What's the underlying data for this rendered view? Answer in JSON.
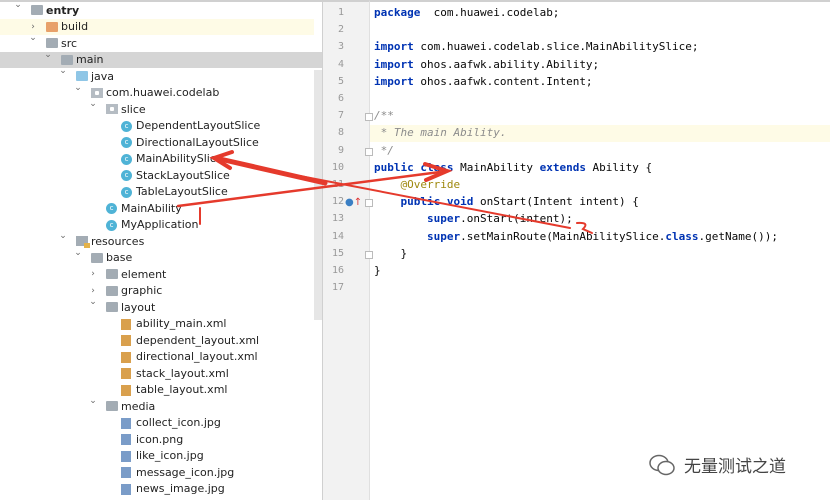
{
  "tree": [
    {
      "label": "entry",
      "level": 0,
      "chev": "down",
      "icon": "module-folder",
      "bold": true
    },
    {
      "label": "build",
      "level": 1,
      "chev": "right",
      "icon": "folder-orange",
      "state": "yellow"
    },
    {
      "label": "src",
      "level": 1,
      "chev": "down",
      "icon": "folder"
    },
    {
      "label": "main",
      "level": 2,
      "chev": "down",
      "icon": "folder",
      "state": "selected"
    },
    {
      "label": "java",
      "level": 3,
      "chev": "down",
      "icon": "folder-blue"
    },
    {
      "label": "com.huawei.codelab",
      "level": 4,
      "chev": "down",
      "icon": "package"
    },
    {
      "label": "slice",
      "level": 5,
      "chev": "down",
      "icon": "package"
    },
    {
      "label": "DependentLayoutSlice",
      "level": 6,
      "icon": "class"
    },
    {
      "label": "DirectionalLayoutSlice",
      "level": 6,
      "icon": "class"
    },
    {
      "label": "MainAbilitySlice",
      "level": 6,
      "icon": "class"
    },
    {
      "label": "StackLayoutSlice",
      "level": 6,
      "icon": "class"
    },
    {
      "label": "TableLayoutSlice",
      "level": 6,
      "icon": "class"
    },
    {
      "label": "MainAbility",
      "level": 5,
      "icon": "class"
    },
    {
      "label": "MyApplication",
      "level": 5,
      "icon": "class"
    },
    {
      "label": "resources",
      "level": 3,
      "chev": "down",
      "icon": "resources"
    },
    {
      "label": "base",
      "level": 4,
      "chev": "down",
      "icon": "folder"
    },
    {
      "label": "element",
      "level": 5,
      "chev": "right",
      "icon": "folder"
    },
    {
      "label": "graphic",
      "level": 5,
      "chev": "right",
      "icon": "folder"
    },
    {
      "label": "layout",
      "level": 5,
      "chev": "down",
      "icon": "folder"
    },
    {
      "label": "ability_main.xml",
      "level": 6,
      "icon": "xml"
    },
    {
      "label": "dependent_layout.xml",
      "level": 6,
      "icon": "xml"
    },
    {
      "label": "directional_layout.xml",
      "level": 6,
      "icon": "xml"
    },
    {
      "label": "stack_layout.xml",
      "level": 6,
      "icon": "xml"
    },
    {
      "label": "table_layout.xml",
      "level": 6,
      "icon": "xml"
    },
    {
      "label": "media",
      "level": 5,
      "chev": "down",
      "icon": "folder"
    },
    {
      "label": "collect_icon.jpg",
      "level": 6,
      "icon": "image"
    },
    {
      "label": "icon.png",
      "level": 6,
      "icon": "image"
    },
    {
      "label": "like_icon.jpg",
      "level": 6,
      "icon": "image"
    },
    {
      "label": "message_icon.jpg",
      "level": 6,
      "icon": "image"
    },
    {
      "label": "news_image.jpg",
      "level": 6,
      "icon": "image"
    }
  ],
  "editor": {
    "highlight_line": 8,
    "lines": [
      [
        [
          "kw",
          "package"
        ],
        [
          "",
          "  com.huawei.codelab;"
        ]
      ],
      [],
      [
        [
          "kw",
          "import"
        ],
        [
          "",
          " com.huawei.codelab.slice.MainAbilitySlice;"
        ]
      ],
      [
        [
          "kw",
          "import"
        ],
        [
          "",
          " ohos.aafwk.ability.Ability;"
        ]
      ],
      [
        [
          "kw",
          "import"
        ],
        [
          "",
          " ohos.aafwk.content.Intent;"
        ]
      ],
      [],
      [
        [
          "cm",
          "/**"
        ]
      ],
      [
        [
          "cm",
          " * The main Ability."
        ]
      ],
      [
        [
          "cm",
          " */"
        ]
      ],
      [
        [
          "kw",
          "public class"
        ],
        [
          "",
          " MainAbility "
        ],
        [
          "kw",
          "extends"
        ],
        [
          "",
          " Ability {"
        ]
      ],
      [
        [
          "an",
          "    @Override"
        ]
      ],
      [
        [
          "",
          "    "
        ],
        [
          "kw",
          "public void"
        ],
        [
          "",
          " onStart(Intent intent) {"
        ]
      ],
      [
        [
          "",
          "        "
        ],
        [
          "kw",
          "super"
        ],
        [
          "",
          ".onStart(intent);"
        ]
      ],
      [
        [
          "",
          "        "
        ],
        [
          "kw",
          "super"
        ],
        [
          "",
          ".setMainRoute(MainAbilitySlice."
        ],
        [
          "kw",
          "class"
        ],
        [
          "",
          ".getName());"
        ]
      ],
      [
        [
          "",
          "    }"
        ]
      ],
      [
        [
          "",
          "}"
        ]
      ],
      []
    ]
  },
  "annotation_color": "#e53a2c",
  "watermark": {
    "text": "无量测试之道",
    "icon": "wechat-icon"
  }
}
